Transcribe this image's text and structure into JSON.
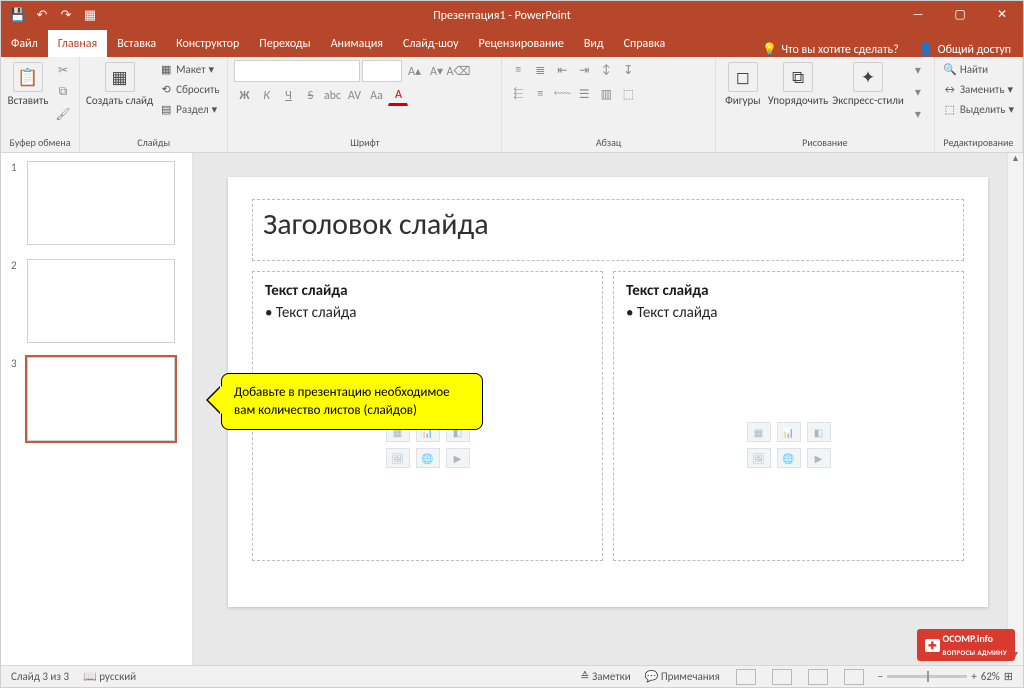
{
  "title": "Презентация1 - PowerPoint",
  "qat": [
    "💾",
    "↶",
    "↷",
    "▦"
  ],
  "winctrl": {
    "min": "—",
    "max": "▢",
    "close": "✕"
  },
  "tabs": [
    "Файл",
    "Главная",
    "Вставка",
    "Конструктор",
    "Переходы",
    "Анимация",
    "Слайд-шоу",
    "Рецензирование",
    "Вид",
    "Справка"
  ],
  "active_tab_index": 1,
  "tell_me": "Что вы хотите сделать?",
  "share": "Общий доступ",
  "ribbon": {
    "clipboard": {
      "paste": "Вставить",
      "label": "Буфер обмена"
    },
    "slides": {
      "new": "Создать слайд",
      "layout": "Макет",
      "reset": "Сбросить",
      "section": "Раздел",
      "label": "Слайды"
    },
    "font": {
      "bold": "Ж",
      "italic": "К",
      "underline": "Ч",
      "strike": "S",
      "shadow": "abc",
      "spacing": "AV",
      "clear": "Аа",
      "label": "Шрифт"
    },
    "paragraph": {
      "label": "Абзац"
    },
    "drawing": {
      "shapes": "Фигуры",
      "arrange": "Упорядочить",
      "quick": "Экспресс-стили",
      "label": "Рисование"
    },
    "editing": {
      "find": "Найти",
      "replace": "Заменить",
      "select": "Выделить",
      "label": "Редактирование"
    }
  },
  "thumbs": [
    1,
    2,
    3
  ],
  "selected_thumb": 3,
  "slide": {
    "title": "Заголовок слайда",
    "col_header": "Текст слайда",
    "bullet": "Текст слайда"
  },
  "callout": "Добавьте в презентацию необходимое вам количество листов (слайдов)",
  "status": {
    "slide": "Слайд 3 из 3",
    "lang": "русский",
    "notes": "Заметки",
    "comments": "Примечания",
    "zoom": "62%"
  },
  "watermark": {
    "brand": "OCOMP.info",
    "sub": "ВОПРОСЫ АДМИНУ"
  }
}
